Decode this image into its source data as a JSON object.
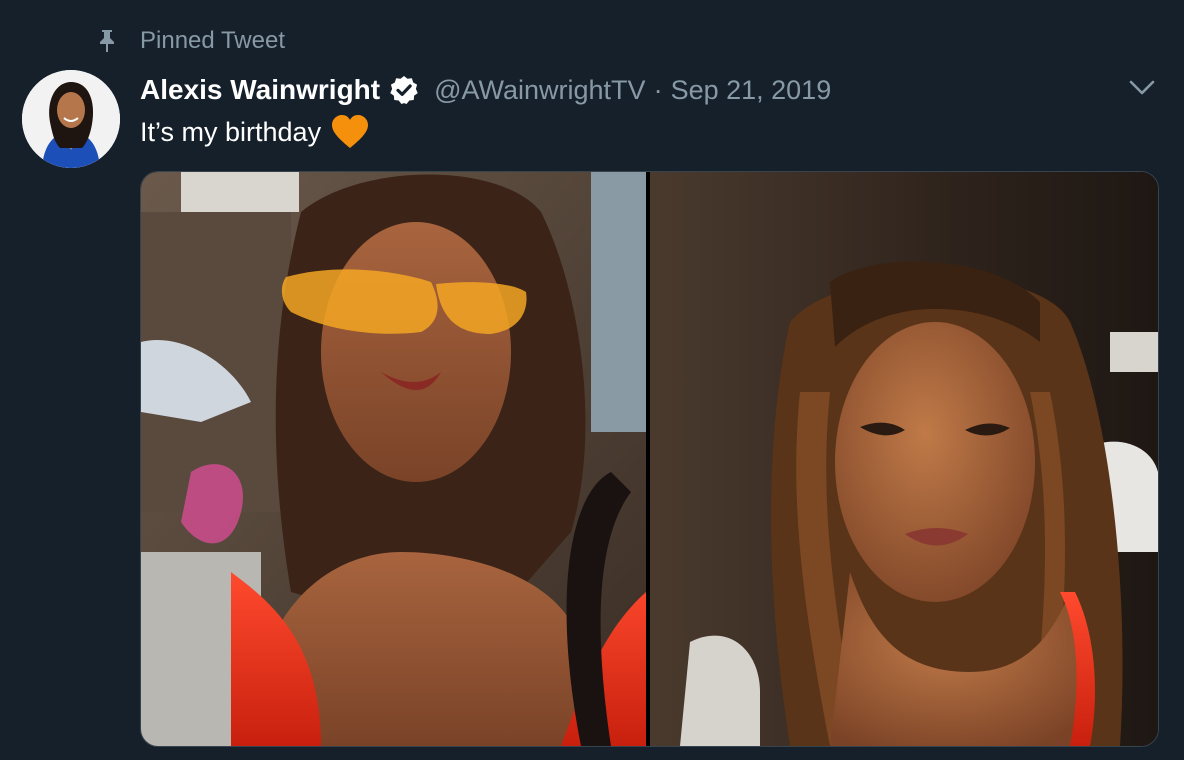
{
  "pinned": {
    "label": "Pinned Tweet",
    "icon": "pin-icon"
  },
  "author": {
    "display_name": "Alexis Wainwright",
    "verified": true,
    "handle": "@AWainwrightTV",
    "separator": "·",
    "date": "Sep 21, 2019",
    "avatar_icon": "avatar"
  },
  "tweet": {
    "text": "It’s my birthday",
    "emoji": "orange-heart-icon"
  },
  "media": {
    "photos": [
      {
        "name": "photo-1"
      },
      {
        "name": "photo-2"
      }
    ]
  },
  "colors": {
    "background": "#15202b",
    "muted": "#8899a6",
    "verified": "#ffffff",
    "heart": "#f4900c",
    "dress": "#e8321e"
  }
}
